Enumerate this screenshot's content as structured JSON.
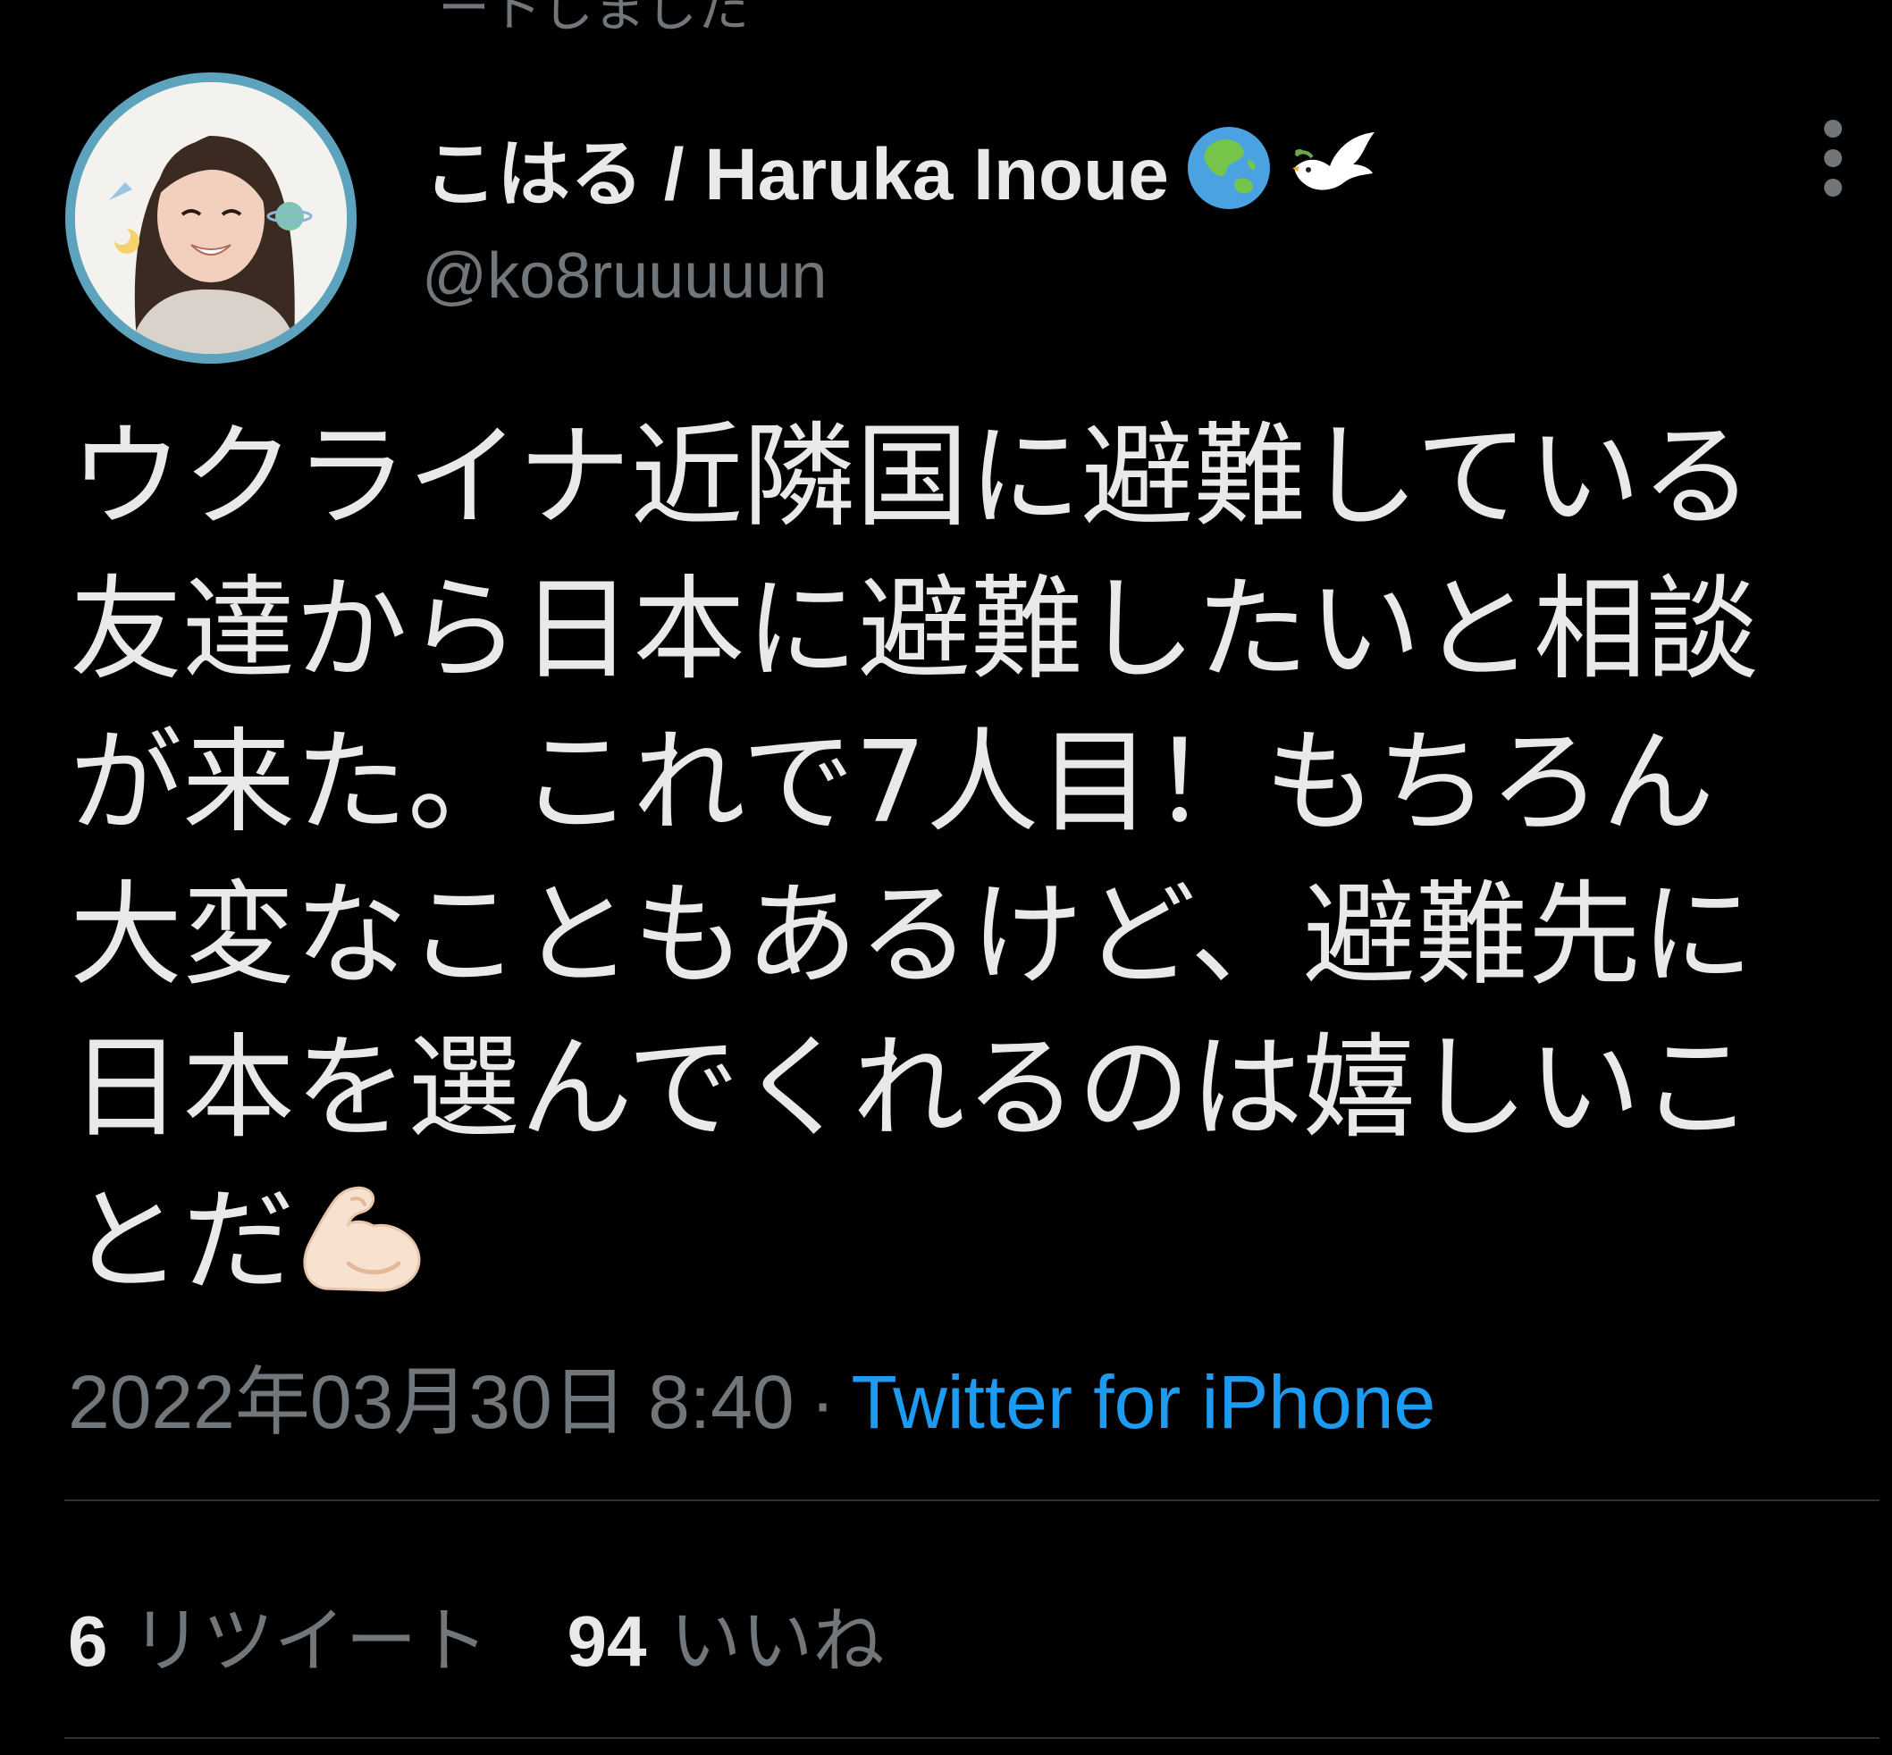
{
  "top_cut_text": "ートしました",
  "author": {
    "display_name": "こはる / Haruka Inoue",
    "handle": "@ko8ruuuuun",
    "emoji_1": "globe-asia-australia-emoji",
    "emoji_2": "dove-emoji"
  },
  "tweet": {
    "lines": [
      "ウクライナ近隣国に避難している",
      "友達から日本に避難したいと相談",
      "が来た。これで7人目！もちろん",
      "大変なこともあるけど、避難先に",
      "日本を選んでくれるのは嬉しいこ",
      "とだ"
    ],
    "trailing_emoji": "flexed-biceps-emoji"
  },
  "meta": {
    "timestamp": "2022年03月30日 8:40",
    "separator": "·",
    "source": "Twitter for iPhone"
  },
  "stats": {
    "retweets_count": "6",
    "retweets_label": "リツイート",
    "likes_count": "94",
    "likes_label": "いいね"
  },
  "colors": {
    "background": "#000000",
    "text": "#e7e9ea",
    "secondary": "#71767b",
    "link": "#1d9bf0",
    "avatar_ring": "#5ea3bd",
    "divider": "#2f3336"
  }
}
